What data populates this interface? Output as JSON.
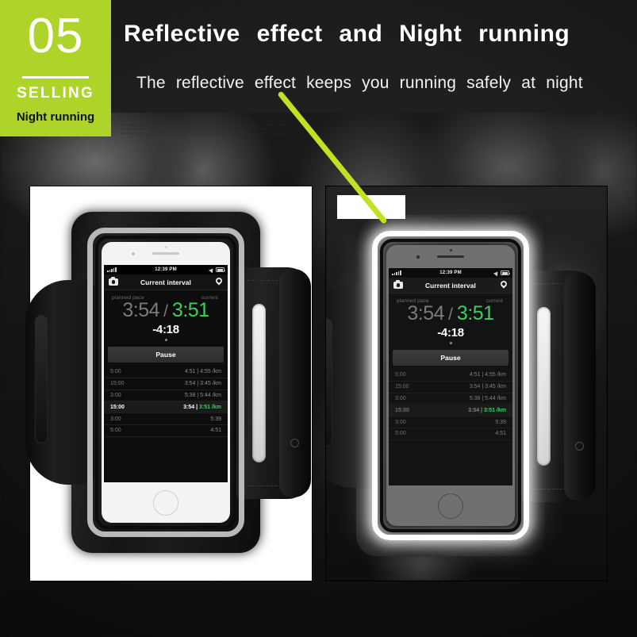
{
  "badge": {
    "number": "05",
    "selling": "SELLING",
    "subtitle": "Night running"
  },
  "header": {
    "headline": "Reflective effect  and  Night running",
    "subline": "The reflective effect keeps you running safely at night",
    "fineprint": [
      "the reflective material on the armband is made of high quality imported reflective film which reflects light back to the source making you visible",
      "at long range in low light conditions the armband keeps your phone secure and dry while you run walk cycle or work out at night",
      "premium soft neoprene fabric is sweat proof and washable with a smooth surface that keeps your device safe and comfortable during exercise"
    ]
  },
  "colors": {
    "badge_green": "#aed42a",
    "arrow_green": "#c3e022",
    "pace_green": "#3ad15c",
    "panel_white": "#ffffff",
    "background_dark": "#141414"
  },
  "icons": {
    "signal": "signal-bars-icon",
    "location": "location-arrow-icon",
    "battery": "battery-icon",
    "camera": "camera-icon",
    "pin": "map-pin-icon",
    "home": "home-button-icon",
    "arrow": "green-pointer-arrow"
  },
  "phone_screen": {
    "status_bar": {
      "time": "12:39 PM"
    },
    "nav": {
      "title": "Current interval"
    },
    "pace": {
      "planned_label": "planned pace",
      "current_label": "current",
      "planned_value": "3:54",
      "separator": "/",
      "current_value": "3:51",
      "delta": "-4:18"
    },
    "pause_label": "Pause",
    "splits": [
      {
        "duration": "5:00",
        "value": "4:51 | 4:55 /km",
        "active": false
      },
      {
        "duration": "15:00",
        "value": "3:54 | 3:45 /km",
        "active": false
      },
      {
        "duration": "3:00",
        "value": "5:38 | 5:44 /km",
        "active": false
      },
      {
        "duration": "15:00",
        "value_plain": "3:54 | ",
        "value_green": "3:51 /km",
        "active": true
      },
      {
        "duration": "3:00",
        "value": "5:39",
        "active": false
      },
      {
        "duration": "5:00",
        "value": "4:51",
        "active": false
      }
    ]
  },
  "panels": {
    "left": {
      "name": "daylight-armband-photo"
    },
    "right": {
      "name": "night-reflective-armband-photo"
    }
  }
}
